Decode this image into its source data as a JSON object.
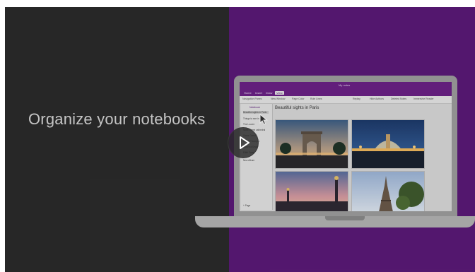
{
  "headline": "Organize your notebooks",
  "app": {
    "window_title": "My notes",
    "ribbon_tabs": [
      "Home",
      "Insert",
      "Draw",
      "View"
    ],
    "active_tab": "View",
    "ribbon_buttons": [
      "Navigation Panes",
      "New Window",
      "Page Color",
      "Rule Lines",
      "Replay",
      "Hide Authors",
      "Deleted Notes",
      "Immersive Reader"
    ],
    "nav": {
      "header": "Notebook",
      "items": [
        "Beautiful sights in Paris",
        "Things to see in Paris",
        "The Louvre",
        "Notre Dame cathedral",
        "Sacre Coeur",
        "Arc de Triomphe",
        "Musee d'Orsay",
        "Eiffel Tower",
        "New Album"
      ],
      "selected_index": 0,
      "footer": "+ Page"
    },
    "page_title": "Beautiful sights in Paris",
    "photos": [
      "arc-de-triomphe-photo",
      "fountain-photo",
      "pont-alexandre-photo",
      "eiffel-tower-photo"
    ]
  },
  "colors": {
    "dark_pane": "#2b2b2b",
    "purple_pane": "#5b1a78",
    "headline_text": "#d6d6d6"
  },
  "icons": [
    "play-icon",
    "mouse-pointer-icon"
  ]
}
